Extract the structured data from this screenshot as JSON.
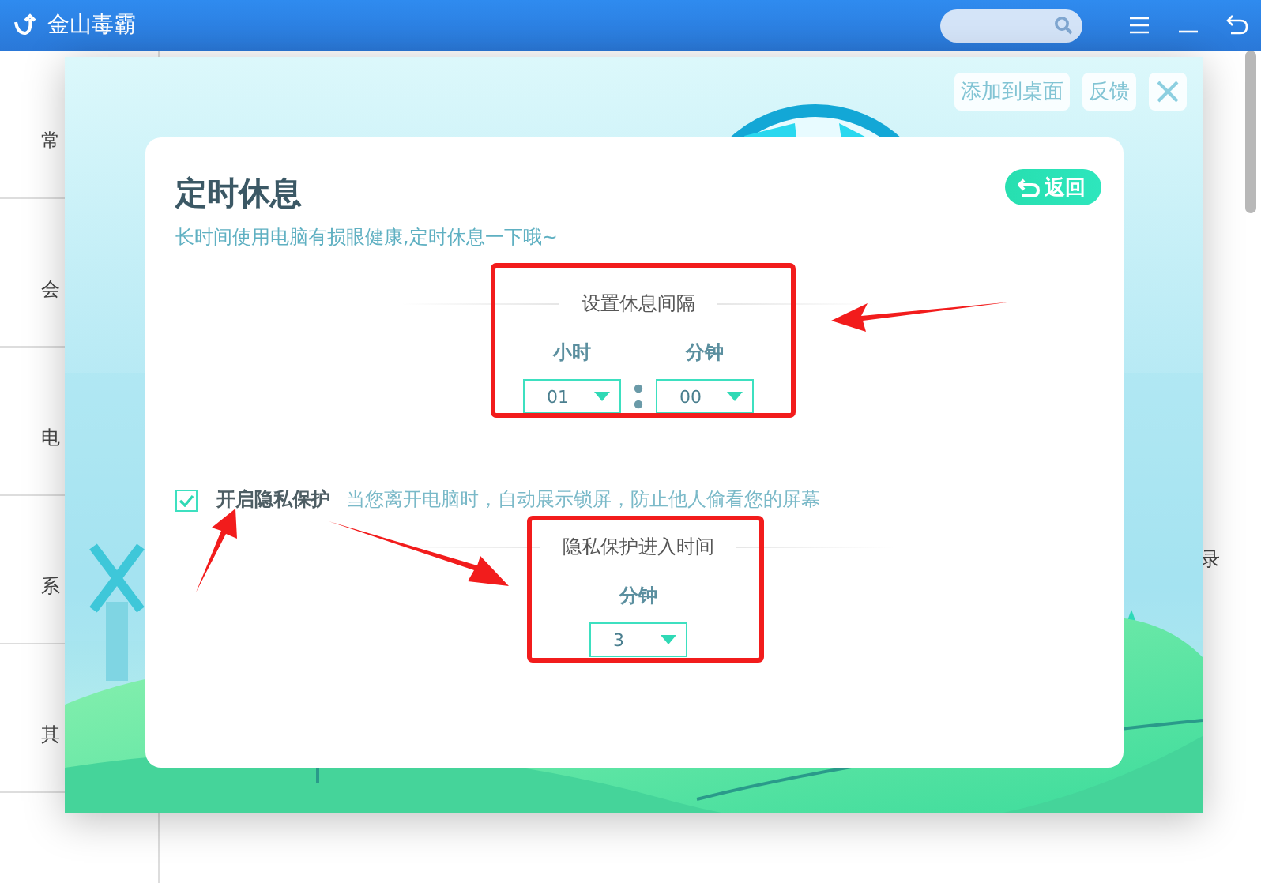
{
  "app": {
    "title": "金山毒霸"
  },
  "sidebar": {
    "items": [
      {
        "label": "常"
      },
      {
        "label": "会"
      },
      {
        "label": "电"
      },
      {
        "label": "系"
      },
      {
        "label": "其"
      }
    ]
  },
  "main": {
    "texts": [
      "录"
    ]
  },
  "dialog": {
    "actions": [
      {
        "label": "添加到桌面"
      },
      {
        "label": "反馈"
      }
    ],
    "title": "定时休息",
    "back_button": "返回",
    "subtitle": "长时间使用电脑有损眼健康,定时休息一下哦~",
    "interval": {
      "heading": "设置休息间隔",
      "fields": [
        {
          "label": "小时",
          "value": "01"
        },
        {
          "label": "分钟",
          "value": "00"
        }
      ]
    },
    "privacy": {
      "checked": true,
      "label": "开启隐私保护",
      "description": "当您离开电脑时，自动展示锁屏，防止他人偷看您的屏幕",
      "heading": "隐私保护进入时间",
      "fields": [
        {
          "label": "分钟",
          "value": "3"
        }
      ]
    }
  }
}
